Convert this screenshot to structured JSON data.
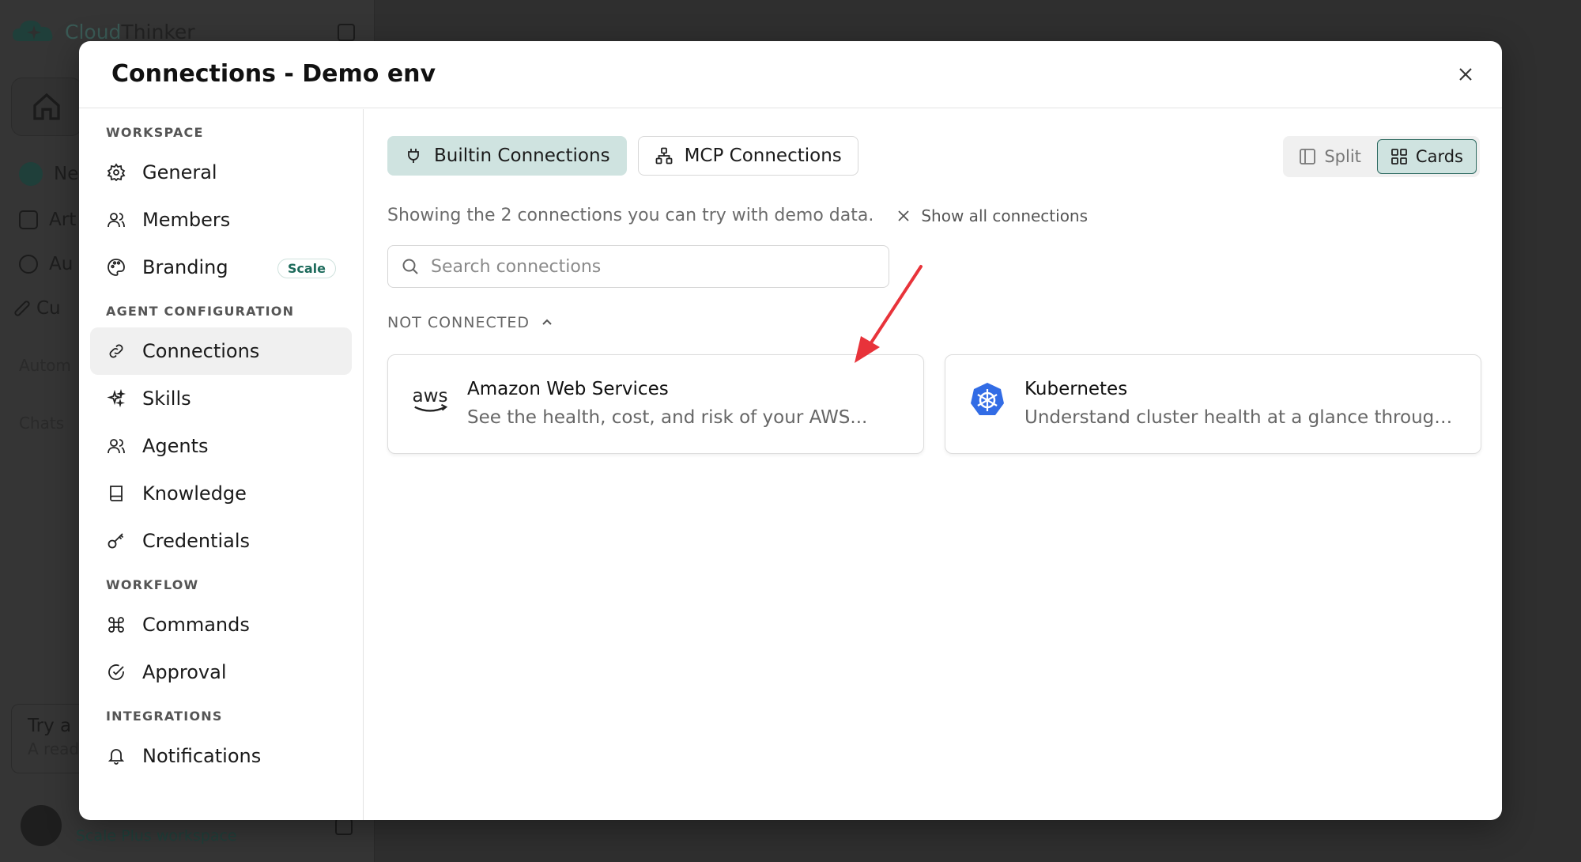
{
  "background": {
    "logo_part1": "Cloud",
    "logo_part2": "Thinker",
    "nav_fragments": [
      "Ne",
      "Art",
      "Au",
      "Cu"
    ],
    "section_fragments": [
      "Autom",
      "Chats"
    ],
    "try_title": "Try a",
    "try_sub": "A read",
    "plan": "Scale Plus workspace"
  },
  "modal": {
    "title": "Connections - Demo env"
  },
  "nav": {
    "sections": [
      {
        "label": "WORKSPACE",
        "items": [
          {
            "label": "General",
            "icon": "gear-icon"
          },
          {
            "label": "Members",
            "icon": "users-icon"
          },
          {
            "label": "Branding",
            "icon": "palette-icon",
            "badge": "Scale"
          }
        ]
      },
      {
        "label": "AGENT CONFIGURATION",
        "items": [
          {
            "label": "Connections",
            "icon": "link-icon",
            "active": true
          },
          {
            "label": "Skills",
            "icon": "sparkles-icon"
          },
          {
            "label": "Agents",
            "icon": "users-icon"
          },
          {
            "label": "Knowledge",
            "icon": "book-icon"
          },
          {
            "label": "Credentials",
            "icon": "key-icon"
          }
        ]
      },
      {
        "label": "WORKFLOW",
        "items": [
          {
            "label": "Commands",
            "icon": "command-icon"
          },
          {
            "label": "Approval",
            "icon": "check-circle-icon"
          }
        ]
      },
      {
        "label": "INTEGRATIONS",
        "items": [
          {
            "label": "Notifications",
            "icon": "bell-icon"
          }
        ]
      }
    ]
  },
  "tabs": {
    "builtin": "Builtin Connections",
    "mcp": "MCP Connections"
  },
  "view_toggle": {
    "split": "Split",
    "cards": "Cards"
  },
  "info": {
    "text": "Showing the 2 connections you can try with demo data.",
    "show_all": "Show all connections"
  },
  "search": {
    "placeholder": "Search connections"
  },
  "group": {
    "label": "NOT CONNECTED"
  },
  "cards": [
    {
      "logo_text": "aws",
      "name": "Amazon Web Services",
      "desc": "See the health, cost, and risk of your AWS..."
    },
    {
      "name": "Kubernetes",
      "desc": "Understand cluster health at a glance through..."
    }
  ],
  "colors": {
    "accent": "#cfe3e0",
    "accent_dark": "#2f6b62",
    "annotation": "#e8333a",
    "k8s_blue": "#326ce5"
  }
}
